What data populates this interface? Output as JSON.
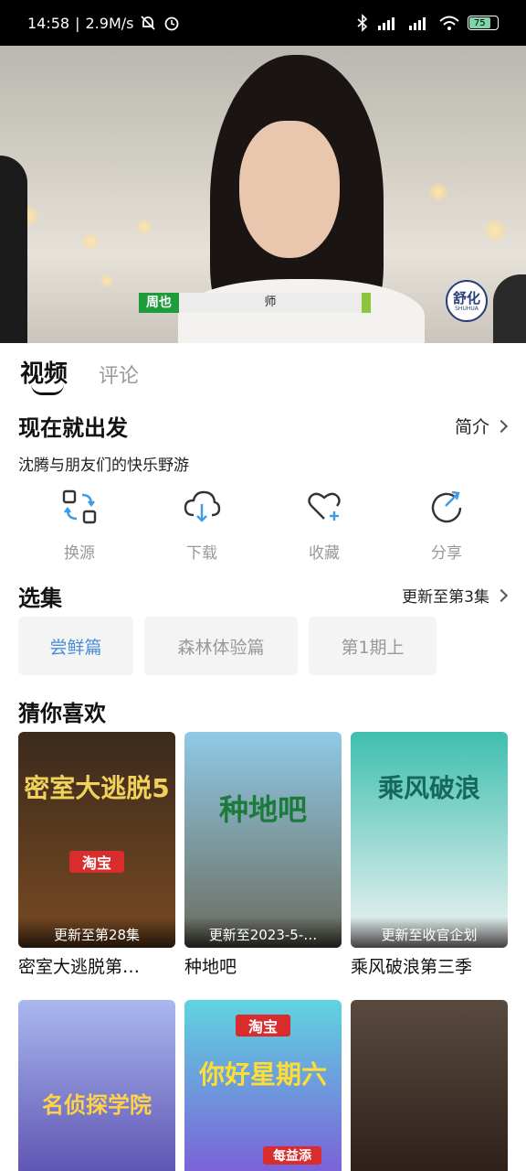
{
  "status_bar": {
    "time": "14:58",
    "speed": "2.9M/s",
    "battery": "75"
  },
  "video": {
    "lower_third_left": "周也",
    "lower_third_mid": "师",
    "logo_big": "舒化",
    "logo_small": "SHUHUA"
  },
  "tabs": [
    {
      "label": "视频",
      "active": true
    },
    {
      "label": "评论",
      "active": false
    }
  ],
  "show": {
    "title": "现在就出发",
    "intro_label": "简介",
    "subtitle": "沈腾与朋友们的快乐野游"
  },
  "actions": [
    {
      "label": "换源",
      "icon": "switch-source-icon"
    },
    {
      "label": "下载",
      "icon": "cloud-download-icon"
    },
    {
      "label": "收藏",
      "icon": "heart-plus-icon"
    },
    {
      "label": "分享",
      "icon": "share-icon"
    }
  ],
  "episodes": {
    "title": "选集",
    "update": "更新至第3集",
    "items": [
      "尝鲜篇",
      "森林体验篇",
      "第1期上"
    ],
    "selected_index": 0
  },
  "recommend": {
    "title": "猜你喜欢",
    "items": [
      {
        "name": "密室大逃脱第…",
        "caption": "更新至第28集",
        "colors": [
          "#3b2a1c",
          "#7a4b23"
        ],
        "poster_text": "密室大逃脱5",
        "poster_text_color": "#f0d25a"
      },
      {
        "name": "种地吧",
        "caption": "更新至2023-5-…",
        "colors": [
          "#8fc9e6",
          "#6b6b5c"
        ],
        "poster_text": "种地吧",
        "poster_text_color": "#1c7a3a"
      },
      {
        "name": "乘风破浪第三季",
        "caption": "更新至收官企划",
        "colors": [
          "#3fbfb0",
          "#f4f4f4"
        ],
        "poster_text": "乘风破浪",
        "poster_text_color": "#16685c"
      },
      {
        "name": "",
        "caption": "",
        "colors": [
          "#a9b8ee",
          "#5b4fb0"
        ],
        "poster_text": "名侦探学院",
        "poster_text_color": "#ffd24a"
      },
      {
        "name": "",
        "caption": "",
        "colors": [
          "#5fd4e0",
          "#7d5ad8"
        ],
        "poster_text": "你好星期六",
        "poster_text_color": "#ffdd33"
      },
      {
        "name": "",
        "caption": "",
        "colors": [
          "#5a4a3e",
          "#2a1e18"
        ],
        "poster_text": "",
        "poster_text_color": "#ffffff"
      }
    ],
    "poster_brand": "淘宝",
    "poster_brand2": "每益添"
  }
}
